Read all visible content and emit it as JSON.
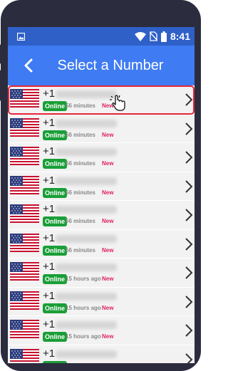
{
  "status_bar": {
    "time": "8:41",
    "icons": [
      "image-icon",
      "wifi-icon",
      "no-sim-icon",
      "battery-icon"
    ]
  },
  "app_bar": {
    "title": "Select a Number",
    "back_icon": "chevron-left-icon"
  },
  "numbers": [
    {
      "prefix": "+1",
      "status": "Online",
      "ago": "56 minutes",
      "tag": "New",
      "selected": true
    },
    {
      "prefix": "+1",
      "status": "Online",
      "ago": "56 minutes",
      "tag": "New"
    },
    {
      "prefix": "+1",
      "status": "Online",
      "ago": "56 minutes",
      "tag": "New"
    },
    {
      "prefix": "+1",
      "status": "Online",
      "ago": "56 minutes",
      "tag": "New"
    },
    {
      "prefix": "+1",
      "status": "Online",
      "ago": "56 minutes",
      "tag": "New"
    },
    {
      "prefix": "+1",
      "status": "Online",
      "ago": "56 minutes",
      "tag": "New"
    },
    {
      "prefix": "+1",
      "status": "Online",
      "ago": "15 hours ago",
      "tag": "New"
    },
    {
      "prefix": "+1",
      "status": "Online",
      "ago": "15 hours ago",
      "tag": "New"
    },
    {
      "prefix": "+1",
      "status": "Online",
      "ago": "15 hours ago",
      "tag": "New"
    },
    {
      "prefix": "+1",
      "status": "Online",
      "ago": "",
      "tag": ""
    }
  ],
  "colors": {
    "status_bar": "#2f60c8",
    "app_bar": "#3f7bf2",
    "online_badge": "#1a9e37",
    "new_tag": "#e0245e",
    "selected_outline": "#e8263a",
    "phone_frame": "#2b2d3e"
  }
}
